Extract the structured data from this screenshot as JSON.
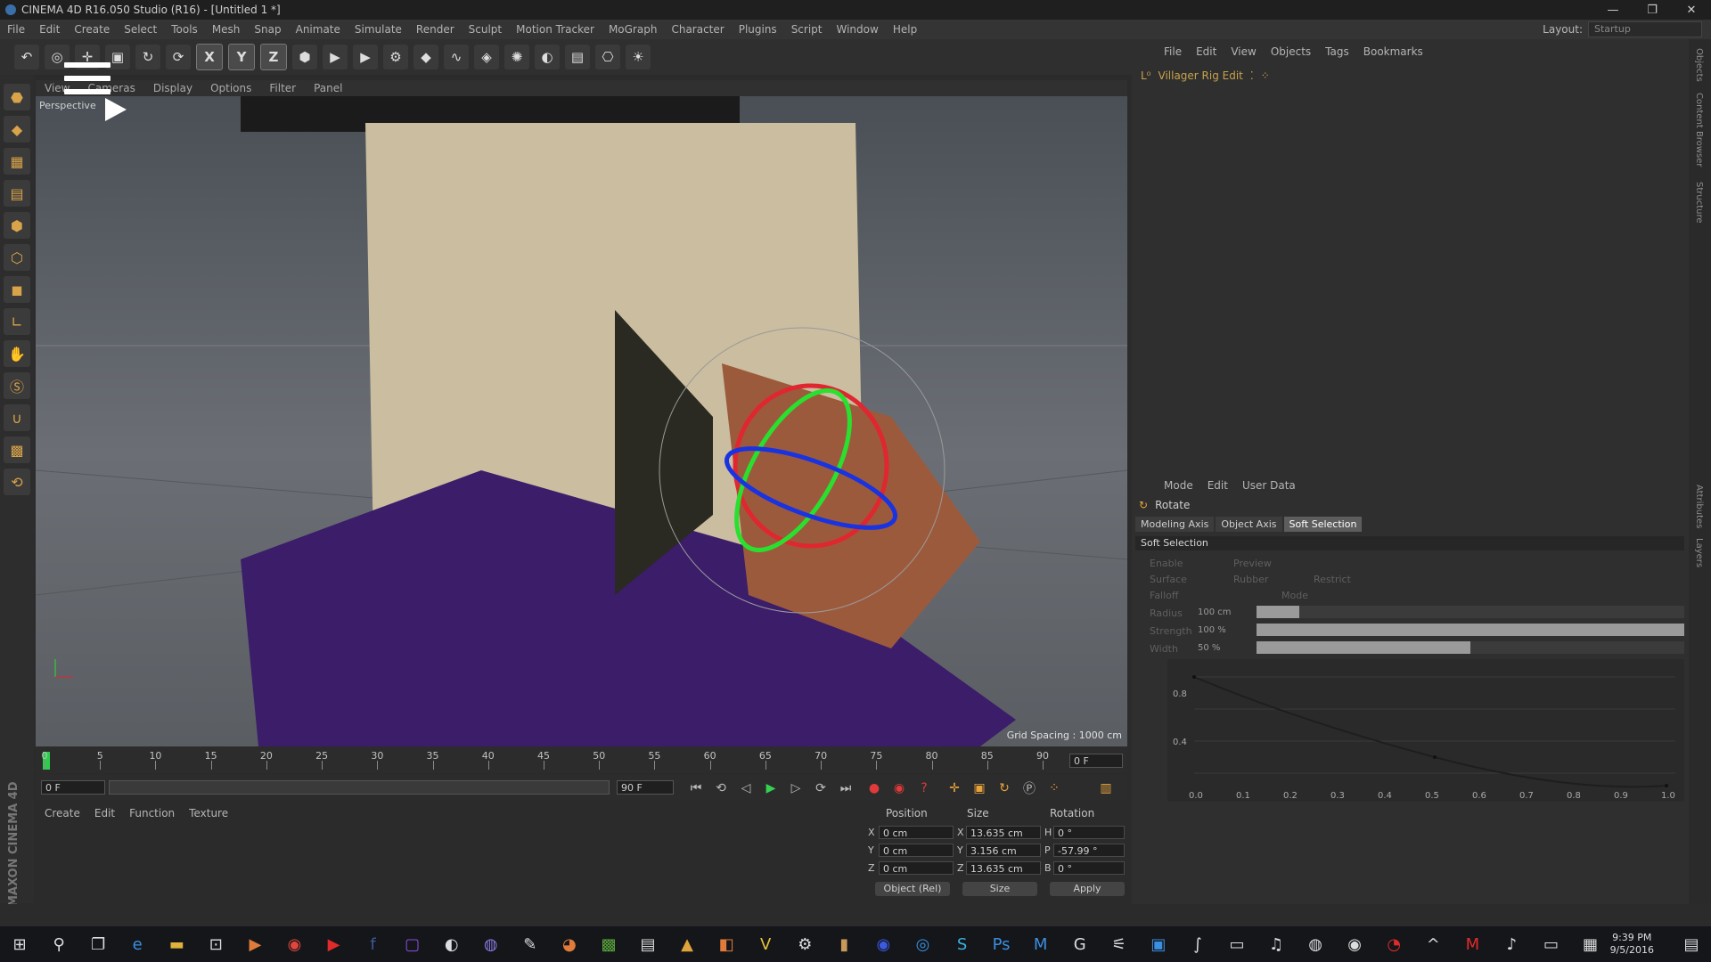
{
  "titlebar": {
    "title": "CINEMA 4D R16.050 Studio (R16) - [Untitled 1 *]",
    "minimize": "—",
    "maximize": "❐",
    "close": "✕"
  },
  "menubar": {
    "items": [
      "File",
      "Edit",
      "Create",
      "Select",
      "Tools",
      "Mesh",
      "Snap",
      "Animate",
      "Simulate",
      "Render",
      "Sculpt",
      "Motion Tracker",
      "MoGraph",
      "Character",
      "Plugins",
      "Script",
      "Window",
      "Help"
    ],
    "layout_label": "Layout:",
    "layout_value": "Startup"
  },
  "toolbar": {
    "axis_x": "X",
    "axis_y": "Y",
    "axis_z": "Z"
  },
  "viewport": {
    "menu": [
      "View",
      "Cameras",
      "Display",
      "Options",
      "Filter",
      "Panel"
    ],
    "camera_label": "Perspective",
    "grid_spacing": "Grid Spacing : 1000 cm",
    "colors": {
      "hat": "#1b1b1b",
      "head": "#cbbd9f",
      "robe": "#3b1d6a",
      "arm": "#9c5a3c",
      "gizmo_x": "#e0262f",
      "gizmo_y": "#29e02f",
      "gizmo_z": "#1a33e0"
    }
  },
  "timeline": {
    "ticks": [
      0,
      5,
      10,
      15,
      20,
      25,
      30,
      35,
      40,
      45,
      50,
      55,
      60,
      65,
      70,
      75,
      80,
      85,
      90
    ],
    "current_frame": "0 F",
    "start_frame": "0 F",
    "end_frame": "90 F"
  },
  "material_manager": {
    "menu": [
      "Create",
      "Edit",
      "Function",
      "Texture"
    ]
  },
  "branding": "MAXON CINEMA 4D",
  "coordinates": {
    "headers": {
      "position": "Position",
      "size": "Size",
      "rotation": "Rotation"
    },
    "rows": [
      {
        "axis": "X",
        "pos": "0 cm",
        "size_axis": "X",
        "size": "13.635 cm",
        "rot_axis": "H",
        "rot": "0 °"
      },
      {
        "axis": "Y",
        "pos": "0 cm",
        "size_axis": "Y",
        "size": "3.156 cm",
        "rot_axis": "P",
        "rot": "-57.99 °"
      },
      {
        "axis": "Z",
        "pos": "0 cm",
        "size_axis": "Z",
        "size": "13.635 cm",
        "rot_axis": "B",
        "rot": "0 °"
      }
    ],
    "mode_select": "Object (Rel)",
    "size_select": "Size",
    "apply": "Apply"
  },
  "object_manager": {
    "menu": [
      "File",
      "Edit",
      "View",
      "Objects",
      "Tags",
      "Bookmarks"
    ],
    "object_name": "Villager Rig Edit"
  },
  "attributes": {
    "menu": [
      "Mode",
      "Edit",
      "User Data"
    ],
    "tool_name": "Rotate",
    "tabs": [
      "Modeling Axis",
      "Object Axis",
      "Soft Selection"
    ],
    "section": "Soft Selection",
    "checks": [
      "Enable",
      "Preview",
      "Surface",
      "Rubber",
      "Restrict"
    ],
    "falloff_label": "Falloff",
    "mode_label": "Mode",
    "radius_label": "Radius",
    "radius_value": "100 cm",
    "radius_fraction": 0.1,
    "strength_label": "Strength",
    "strength_value": "100 %",
    "strength_fraction": 1.0,
    "width_label": "Width",
    "width_value": "50 %",
    "width_fraction": 0.5,
    "curve_y_ticks": [
      "0.8",
      "0.4"
    ],
    "curve_x_ticks": [
      "0.0",
      "0.1",
      "0.2",
      "0.3",
      "0.4",
      "0.5",
      "0.6",
      "0.7",
      "0.8",
      "0.9",
      "1.0"
    ]
  },
  "side_tabs": [
    "Objects",
    "Content Browser",
    "Structure",
    "Attributes",
    "Layers"
  ],
  "taskbar": {
    "time": "9:39 PM",
    "date": "9/5/2016"
  }
}
